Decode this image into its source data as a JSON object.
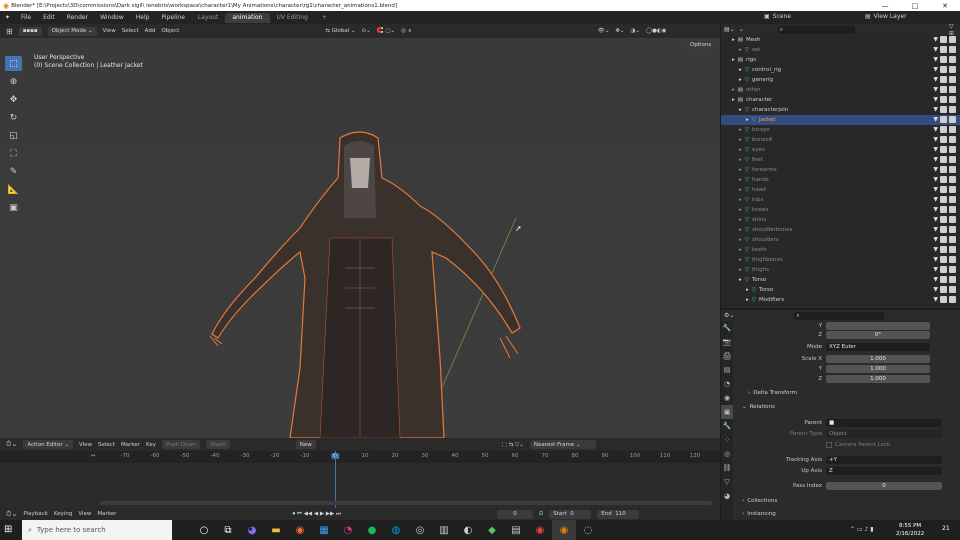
{
  "window": {
    "title": "Blender* [E:\\Projects\\3D\\commissions\\Dark sigil\\ lenebris\\workspace\\character1\\My Animations\\character\\rg1\\character_animations1.blend]"
  },
  "menu": {
    "items": [
      "File",
      "Edit",
      "Render",
      "Window",
      "Help",
      "Pipeline"
    ],
    "workspaces": [
      "Layout",
      "animation",
      "UV Editing",
      "+"
    ],
    "scene_label": "Scene",
    "view_layer_label": "View Layer"
  },
  "viewport": {
    "mode": "Object Mode",
    "menus": [
      "View",
      "Select",
      "Add",
      "Object"
    ],
    "orientation": "Global",
    "options_label": "Options",
    "overlay_line1": "User Perspective",
    "overlay_line2": "(0) Scene Collection | Leather jacket"
  },
  "outliner": {
    "search_placeholder": "",
    "rows": [
      {
        "label": "Mesh",
        "indent": 1,
        "dim": false,
        "sel": false
      },
      {
        "label": "set",
        "indent": 2,
        "dim": true,
        "sel": false
      },
      {
        "label": "rigs",
        "indent": 1,
        "dim": false,
        "sel": false
      },
      {
        "label": "control_rig",
        "indent": 2,
        "dim": false,
        "sel": false
      },
      {
        "label": "generig",
        "indent": 2,
        "dim": false,
        "sel": false
      },
      {
        "label": "other",
        "indent": 1,
        "dim": true,
        "sel": false
      },
      {
        "label": "character",
        "indent": 1,
        "dim": false,
        "sel": false
      },
      {
        "label": "characterjoin",
        "indent": 2,
        "dim": false,
        "sel": false
      },
      {
        "label": "Jacket",
        "indent": 3,
        "dim": false,
        "sel": true
      },
      {
        "label": "biceps",
        "indent": 2,
        "dim": true,
        "sel": false
      },
      {
        "label": "bones4",
        "indent": 2,
        "dim": true,
        "sel": false
      },
      {
        "label": "eyes",
        "indent": 2,
        "dim": true,
        "sel": false
      },
      {
        "label": "feet",
        "indent": 2,
        "dim": true,
        "sel": false
      },
      {
        "label": "forearms",
        "indent": 2,
        "dim": true,
        "sel": false
      },
      {
        "label": "hands",
        "indent": 2,
        "dim": true,
        "sel": false
      },
      {
        "label": "head",
        "indent": 2,
        "dim": true,
        "sel": false
      },
      {
        "label": "hips",
        "indent": 2,
        "dim": true,
        "sel": false
      },
      {
        "label": "knees",
        "indent": 2,
        "dim": true,
        "sel": false
      },
      {
        "label": "shins",
        "indent": 2,
        "dim": true,
        "sel": false
      },
      {
        "label": "shoulderbones",
        "indent": 2,
        "dim": true,
        "sel": false
      },
      {
        "label": "shoulders",
        "indent": 2,
        "dim": true,
        "sel": false
      },
      {
        "label": "teeth",
        "indent": 2,
        "dim": true,
        "sel": false
      },
      {
        "label": "thighbones",
        "indent": 2,
        "dim": true,
        "sel": false
      },
      {
        "label": "thighs",
        "indent": 2,
        "dim": true,
        "sel": false
      },
      {
        "label": "Torso",
        "indent": 2,
        "dim": false,
        "sel": false
      },
      {
        "label": "Torso",
        "indent": 3,
        "dim": false,
        "sel": false
      },
      {
        "label": "Modifiers",
        "indent": 3,
        "dim": false,
        "sel": false
      }
    ]
  },
  "properties": {
    "rotation_y": "",
    "rotation_z_label": "Z",
    "rotation_z": "0°",
    "mode_label": "Mode",
    "mode_value": "XYZ Euler",
    "scale_x_label": "Scale X",
    "scale_x": "1.000",
    "scale_y_label": "Y",
    "scale_y": "1.000",
    "scale_z_label": "Z",
    "scale_z": "1.000",
    "delta_transform": "Delta Transform",
    "relations": "Relations",
    "parent_label": "Parent",
    "parent_type_label": "Parent Type",
    "parent_type_value": "Object",
    "camera_parent_lock": "Camera Parent Lock",
    "tracking_axis_label": "Tracking Axis",
    "tracking_axis_value": "+Y",
    "up_axis_label": "Up Axis",
    "up_axis_value": "Z",
    "pass_index_label": "Pass Index",
    "pass_index_value": "0",
    "collections": "Collections",
    "instancing": "Instancing"
  },
  "timeline": {
    "editor": "Action Editor",
    "menus": [
      "View",
      "Select",
      "Marker",
      "Key"
    ],
    "push_down": "Push Down",
    "stash": "Stash",
    "new_label": "New",
    "snap": "Nearest Frame",
    "ticks": [
      "-70",
      "-60",
      "-50",
      "-40",
      "-30",
      "-20",
      "-10",
      "0",
      "10",
      "20",
      "30",
      "40",
      "50",
      "60",
      "70",
      "80",
      "90",
      "100",
      "110",
      "120"
    ],
    "current_frame": "0"
  },
  "playback": {
    "menus": [
      "Playback",
      "Keying",
      "View",
      "Marker"
    ],
    "frame": "0",
    "start_label": "Start",
    "start_value": "0",
    "end_label": "End",
    "end_value": "110"
  },
  "taskbar": {
    "search_placeholder": "Type here to search",
    "time": "8:55 PM",
    "date": "2/16/2022",
    "notif": "21"
  },
  "colors": {
    "accent": "#4772b3",
    "selection_outline": "#e8783a",
    "viewport_bg": "#3a3a3a"
  }
}
